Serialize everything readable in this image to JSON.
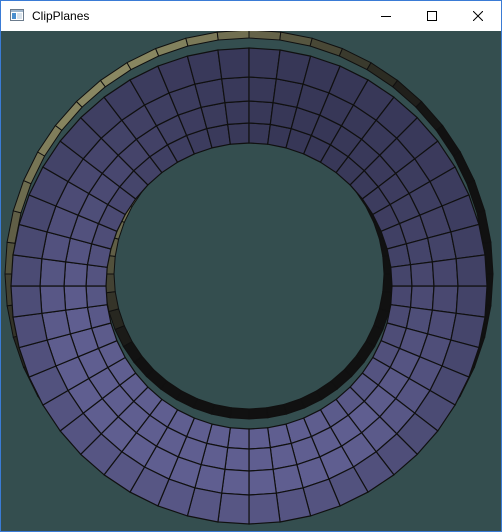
{
  "window": {
    "title": "ClipPlanes",
    "icons": {
      "app": "window-app-icon",
      "minimize": "minimize-icon",
      "maximize": "maximize-icon",
      "close": "close-icon"
    }
  },
  "scene": {
    "object": "torus",
    "colors": {
      "background": "#344e4f",
      "front_face": "#5f5e90",
      "back_face_lit": "#8a8862",
      "back_face_dark": "#111111",
      "grid_lines": "#101010",
      "window_border": "#3a7bd5"
    }
  }
}
